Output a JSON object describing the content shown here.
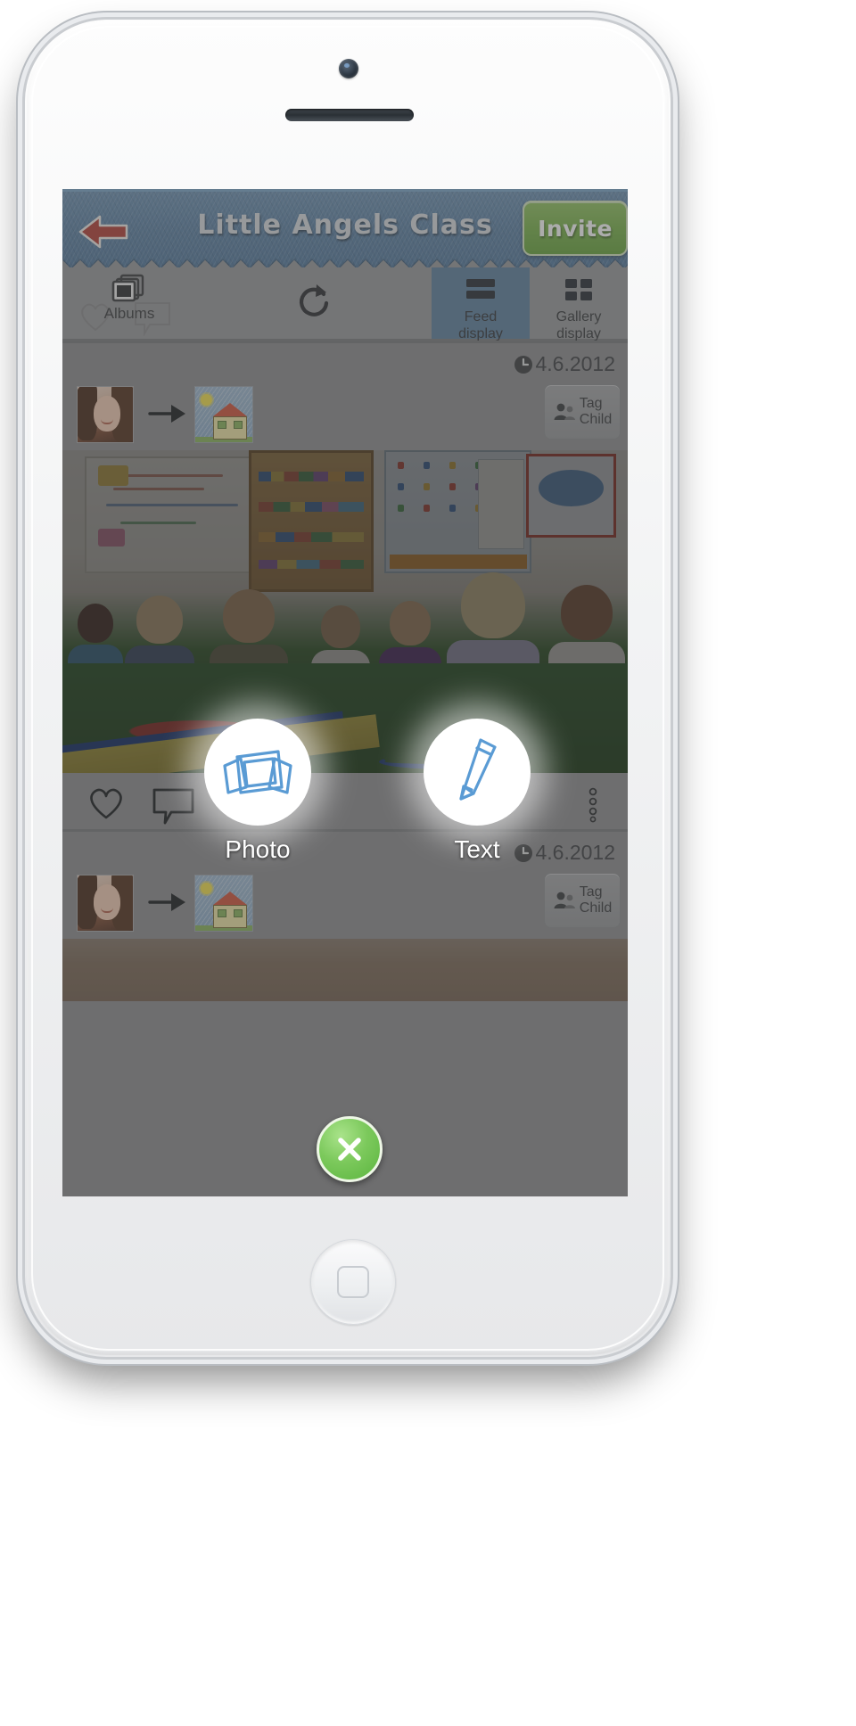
{
  "device": {
    "name": "smartphone-mockup",
    "camera": "front-camera",
    "earpiece": "earpiece-speaker",
    "home_button": "home-button"
  },
  "header": {
    "title": "Little Angels Class",
    "back_icon": "back-arrow-icon",
    "invite_label": "Invite",
    "bg_color": "#5d82a5",
    "invite_color": "#7bb44d"
  },
  "toolbar": {
    "albums_label": "Albums",
    "albums_icon": "stacked-photos-icon",
    "refresh_icon": "refresh-icon",
    "feed_display_label": "Feed\ndisplay",
    "feed_display_line1": "Feed",
    "feed_display_line2": "display",
    "feed_display_icon": "list-rows-icon",
    "gallery_display_line1": "Gallery",
    "gallery_display_line2": "display",
    "gallery_display_icon": "grid-squares-icon",
    "active_tab": "Feed display",
    "active_tab_color": "#5f819e"
  },
  "posts": [
    {
      "date": "4.6.2012",
      "clock_icon": "clock-icon",
      "avatar": "teacher-avatar",
      "arrow_icon": "arrow-right-icon",
      "drawing_thumb": "house-drawing-thumbnail",
      "tag_child_line1": "Tag",
      "tag_child_line2": "Child",
      "tag_child_icon": "person-tag-icon",
      "photo": "classroom-children-photo",
      "like_icon": "heart-icon",
      "comment_icon": "comment-bubble-icon",
      "more_icon": "more-options-icon"
    },
    {
      "date": "4.6.2012",
      "clock_icon": "clock-icon",
      "avatar": "teacher-avatar",
      "arrow_icon": "arrow-right-icon",
      "drawing_thumb": "house-drawing-thumbnail",
      "tag_child_line1": "Tag",
      "tag_child_line2": "Child",
      "tag_child_icon": "person-tag-icon",
      "photo": "second-post-photo"
    }
  ],
  "action_menu": {
    "photo_label": "Photo",
    "photo_icon": "stacked-photos-sketch-icon",
    "text_label": "Text",
    "text_icon": "pencil-sketch-icon",
    "close_icon": "close-x-icon",
    "close_color": "#5bb53f",
    "accent_color": "#5a9bd4"
  }
}
